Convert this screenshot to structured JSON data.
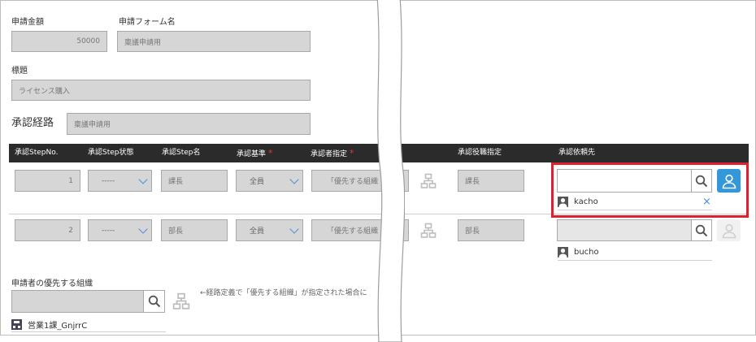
{
  "form": {
    "amount_label": "申請金額",
    "amount_value": "50000",
    "form_name_label": "申請フォーム名",
    "form_name_value": "稟議申請用",
    "title_label": "標題",
    "title_value": "ライセンス購入",
    "route_label": "承認経路",
    "route_value": "稟議申請用"
  },
  "table": {
    "headers": {
      "step_no": "承認StepNo.",
      "step_status": "承認Step状態",
      "step_name": "承認Step名",
      "criteria": "承認基準",
      "approver_spec": "承認者指定",
      "role_spec": "承認役職指定",
      "request_to": "承認依頼先"
    },
    "required_mark": "*",
    "rows": [
      {
        "no": "1",
        "status": "-----",
        "name": "課長",
        "criteria": "全員",
        "approver": "「優先する組織",
        "role": "課長",
        "user": "kacho",
        "remove": "×"
      },
      {
        "no": "2",
        "status": "-----",
        "name": "部長",
        "criteria": "全員",
        "approver": "「優先する組織",
        "role": "部長",
        "user": "bucho"
      }
    ]
  },
  "org": {
    "label": "申請者の優先する組織",
    "note": "←経路定義で「優先する組織」が指定された場合に",
    "selected": "営業1課_GnjrrC"
  },
  "colors": {
    "header_bg": "#2b2b2b",
    "field_bg": "#d6d6d6",
    "accent": "#3497d9",
    "highlight": "#e02030",
    "required": "#e53935"
  }
}
